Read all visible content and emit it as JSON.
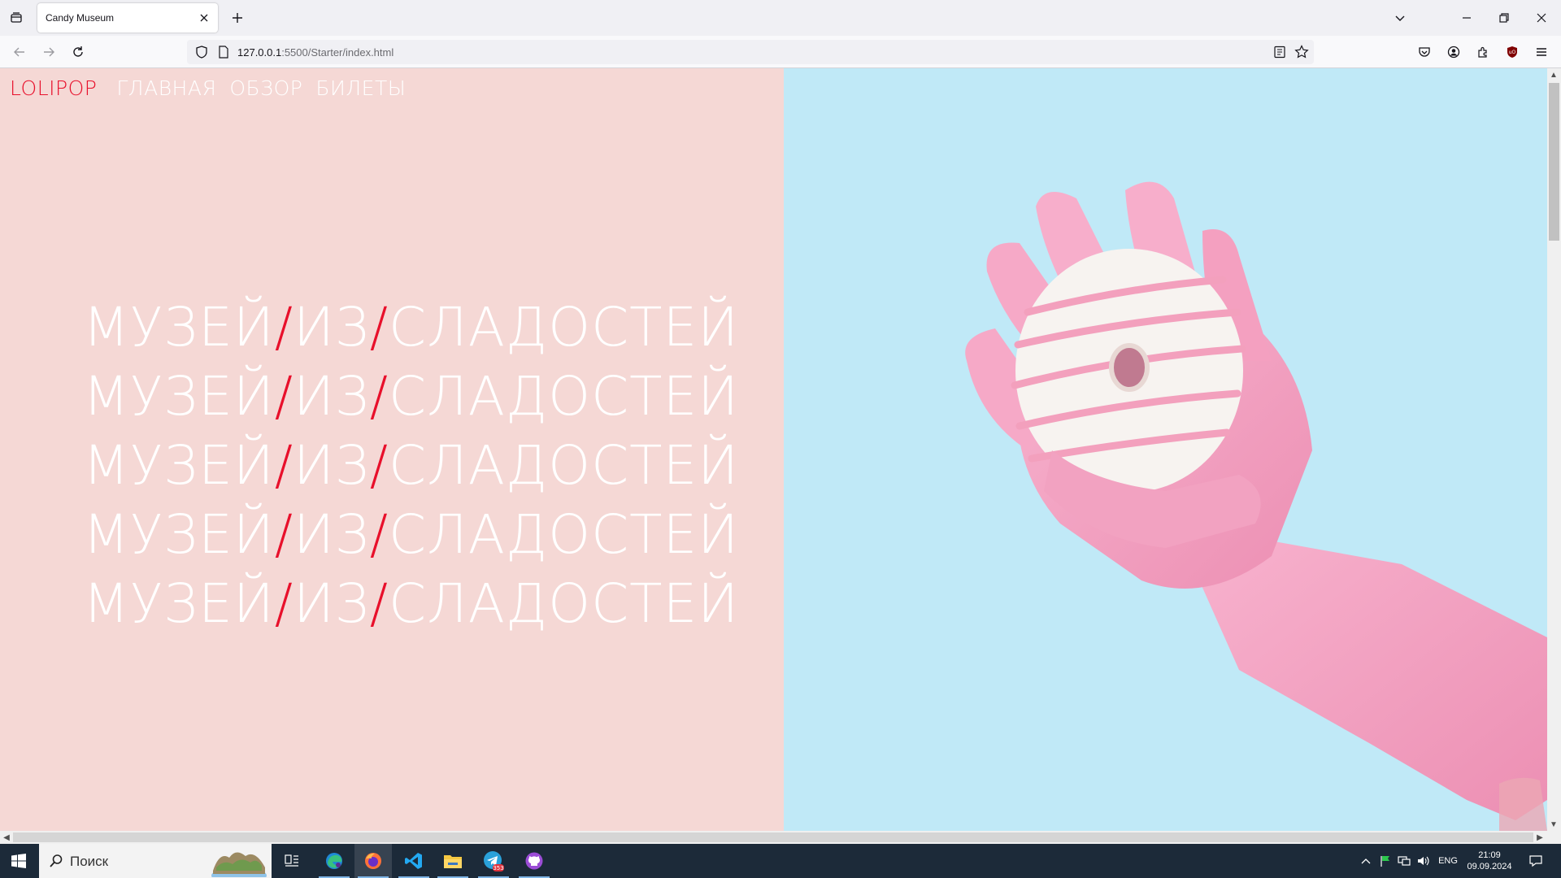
{
  "browser": {
    "tab_title": "Candy Museum",
    "url_host": "127.0.0.1",
    "url_path": ":5500/Starter/index.html"
  },
  "site": {
    "logo": "LOLIPOP",
    "nav": [
      "ГЛАВНАЯ",
      "ОБЗОР",
      "БИЛЕТЫ"
    ],
    "headline_words": [
      "МУЗЕЙ",
      "ИЗ",
      "СЛАДОСТЕЙ"
    ],
    "separator": "/",
    "headline_repeat": 5
  },
  "colors": {
    "left_bg": "#f5d8d5",
    "right_bg": "#c0e9f7",
    "accent": "#e8102b",
    "glove": "#f5a3c2",
    "donut_glaze": "#f7f3f0",
    "donut_stripe": "#f3a0bd"
  },
  "taskbar": {
    "search_placeholder": "Поиск",
    "language": "ENG",
    "time": "21:09",
    "date": "09.09.2024",
    "telegram_badge": "353"
  }
}
